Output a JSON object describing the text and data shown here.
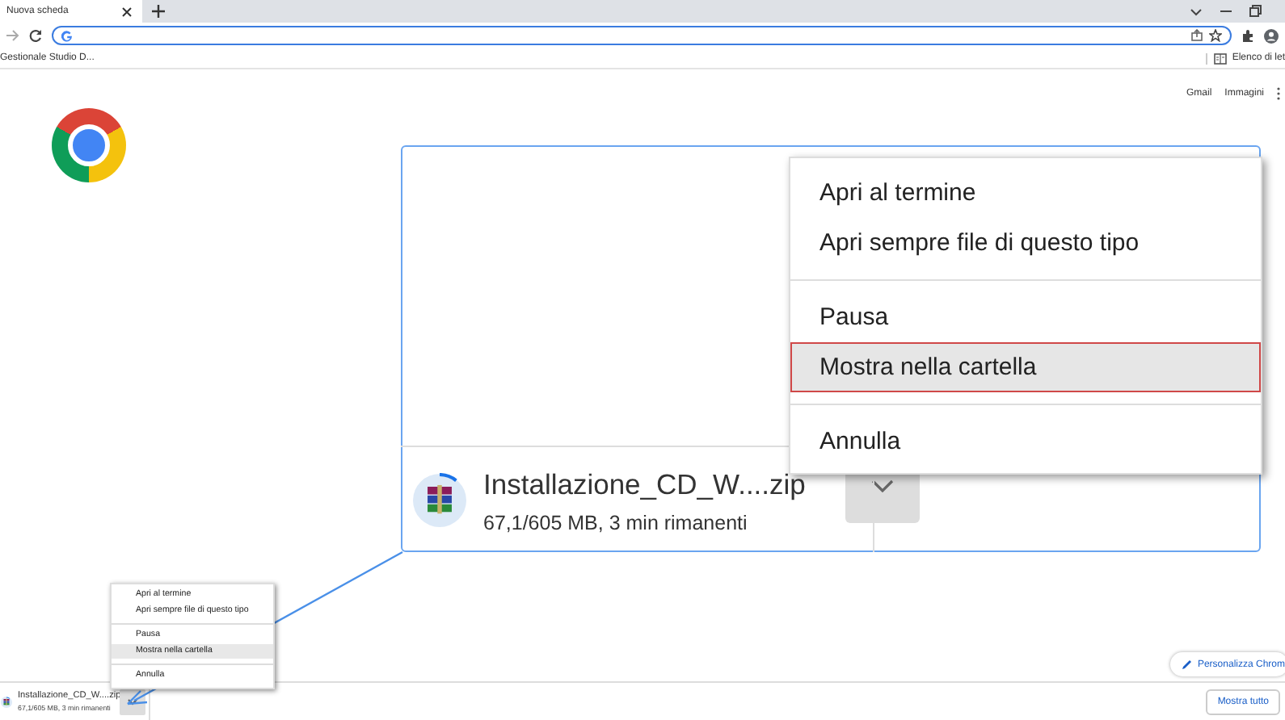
{
  "tabs": [
    {
      "label": "Nuova scheda",
      "selected": true
    }
  ],
  "bookmarks": [
    {
      "label": "Gestionale Studio D..."
    }
  ],
  "reading_list": {
    "label": "Elenco di let"
  },
  "header_links": [
    "Gmail",
    "Immagini"
  ],
  "customize_button": {
    "label": "Personalizza Chrom"
  },
  "callout": {
    "download": {
      "filename": "Installazione_CD_W....zip",
      "status": "67,1/605 MB, 3 min rimanenti",
      "level": 0.11
    },
    "menu": {
      "groups": [
        [
          {
            "label": "Apri al termine",
            "selected": false
          },
          {
            "label": "Apri sempre file di questo tipo",
            "selected": false
          }
        ],
        [
          {
            "label": "Pausa",
            "selected": false
          },
          {
            "label": "Mostra nella cartella",
            "selected": true
          }
        ],
        [
          {
            "label": "Annulla",
            "selected": false
          }
        ]
      ]
    }
  },
  "menu": {
    "groups": [
      [
        {
          "label": "Apri al termine",
          "selected": false
        },
        {
          "label": "Apri sempre file di questo tipo",
          "selected": false
        }
      ],
      [
        {
          "label": "Pausa",
          "selected": false
        },
        {
          "label": "Mostra nella cartella",
          "selected": true
        }
      ],
      [
        {
          "label": "Annulla",
          "selected": false
        }
      ]
    ]
  },
  "download_bar": {
    "download": {
      "filename": "Installazione_CD_W....zip",
      "status": "67,1/605 MB, 3 min rimanenti",
      "level": 0.11
    },
    "show_all_button": "Mostra tutto"
  }
}
